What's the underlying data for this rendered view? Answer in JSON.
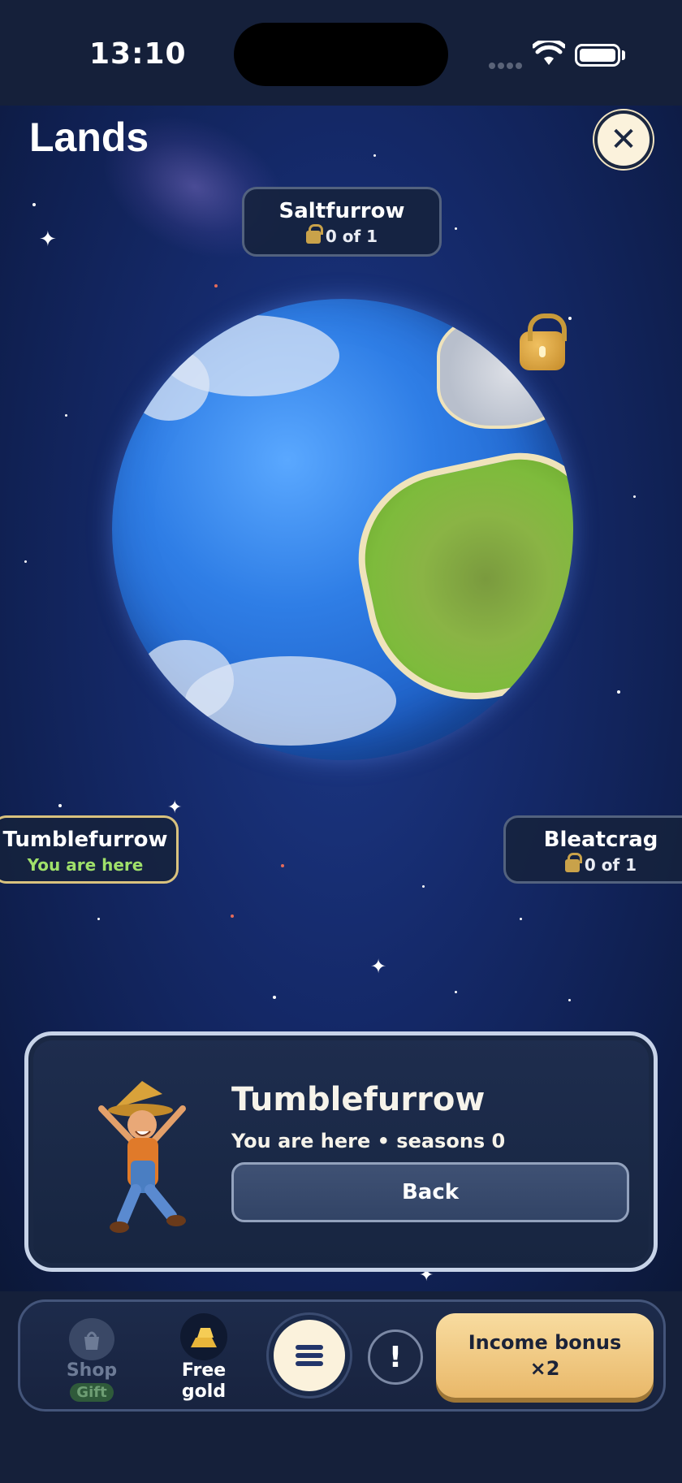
{
  "status": {
    "time": "13:10"
  },
  "header": {
    "title": "Lands"
  },
  "lands": {
    "top": {
      "name": "Saltfurrow",
      "progress": "0 of 1"
    },
    "left": {
      "name": "Tumblefurrow",
      "status": "You are here"
    },
    "right": {
      "name": "Bleatcrag",
      "progress": "0 of 1"
    }
  },
  "card": {
    "title": "Tumblefurrow",
    "subtitle": "You are here • seasons 0",
    "back_label": "Back"
  },
  "nav": {
    "shop_label": "Shop",
    "shop_badge": "Gift",
    "gold_label_1": "Free",
    "gold_label_2": "gold",
    "alert_symbol": "!",
    "income_label": "Income bonus ×2"
  },
  "colors": {
    "accent_gold": "#e9b869",
    "here_green": "#9fe06a",
    "panel": "#1e2d4e"
  }
}
